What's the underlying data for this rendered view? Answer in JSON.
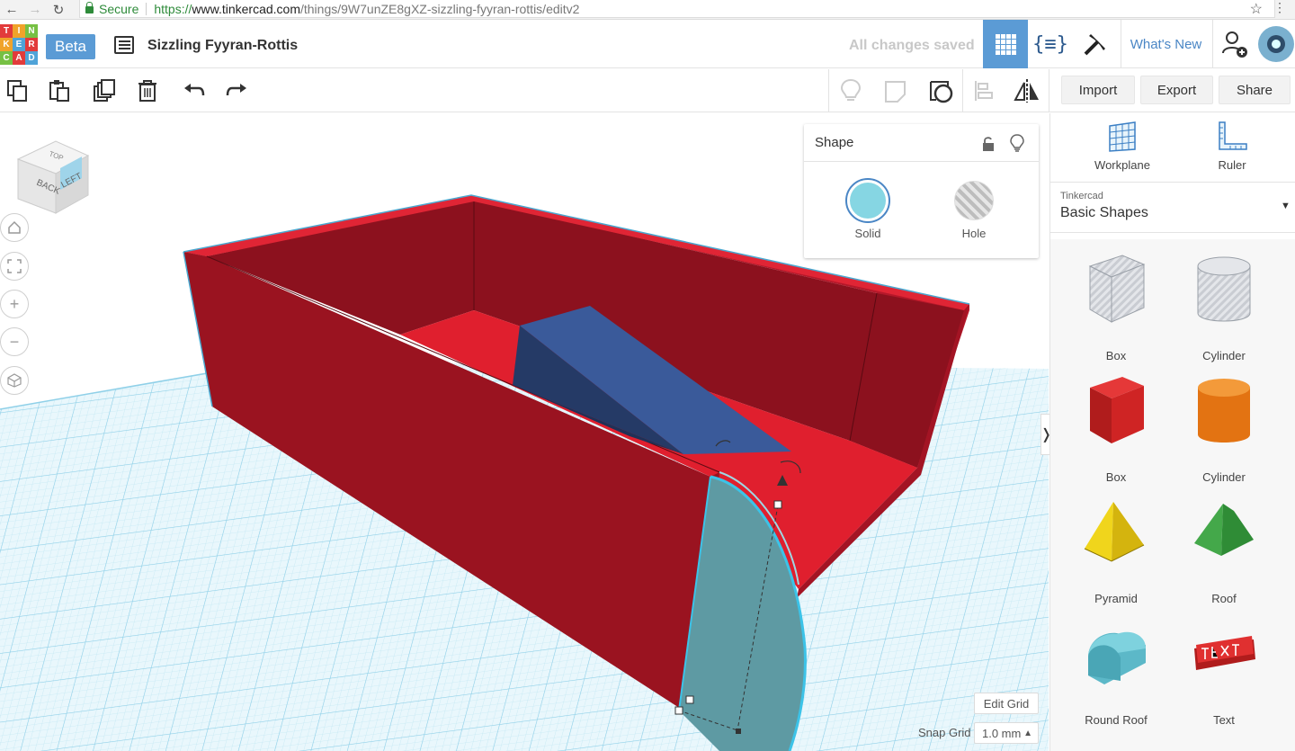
{
  "browser": {
    "secure_label": "Secure",
    "url_scheme": "https://",
    "url_host": "www.tinkercad.com",
    "url_path": "/things/9W7unZE8gXZ-sizzling-fyyran-rottis/editv2"
  },
  "header": {
    "logo_letters": [
      "T",
      "I",
      "N",
      "K",
      "E",
      "R",
      "C",
      "A",
      "D"
    ],
    "beta_label": "Beta",
    "design_title": "Sizzling Fyyran-Rottis",
    "save_status": "All changes saved",
    "whats_new_label": "What's New",
    "code_blocks_glyph": "{≡}"
  },
  "toolbar": {
    "import_label": "Import",
    "export_label": "Export",
    "share_label": "Share"
  },
  "viewcube": {
    "faces": [
      "BACK",
      "LEFT",
      "TOP"
    ]
  },
  "shape_panel": {
    "title": "Shape",
    "solid_label": "Solid",
    "hole_label": "Hole",
    "solid_color": "#86d6e3"
  },
  "right_panel": {
    "workplane_label": "Workplane",
    "ruler_label": "Ruler",
    "library_small": "Tinkercad",
    "library_name": "Basic Shapes",
    "shapes": [
      {
        "label": "Box",
        "icon": "box-hole-icon"
      },
      {
        "label": "Cylinder",
        "icon": "cylinder-hole-icon"
      },
      {
        "label": "Box",
        "icon": "box-red-icon"
      },
      {
        "label": "Cylinder",
        "icon": "cylinder-orange-icon"
      },
      {
        "label": "Pyramid",
        "icon": "pyramid-icon"
      },
      {
        "label": "Roof",
        "icon": "roof-icon"
      },
      {
        "label": "Round Roof",
        "icon": "round-roof-icon"
      },
      {
        "label": "Text",
        "icon": "text-icon"
      }
    ]
  },
  "grid_controls": {
    "edit_grid_label": "Edit Grid",
    "snap_grid_label": "Snap Grid",
    "snap_value": "1.0 mm"
  },
  "colors": {
    "accent": "#5b9bd5",
    "model_red": "#d81f2c",
    "model_blue": "#3a5a9a",
    "selected_teal": "#6aa2ab",
    "grid": "#b9e4f2"
  }
}
